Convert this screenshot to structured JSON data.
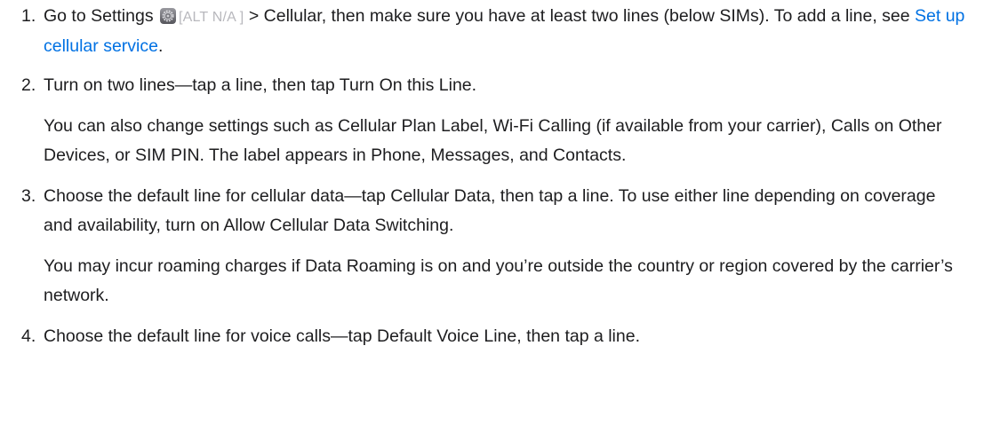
{
  "steps": [
    {
      "number": "1.",
      "parts": {
        "a": "Go to Settings ",
        "alt": "[ALT N/A ]",
        "b": " > Cellular, then make sure you have at least two lines (below SIMs). To add a line, see ",
        "link": "Set up cellular service",
        "c": "."
      },
      "icon": "settings-gear-icon"
    },
    {
      "number": "2.",
      "text": "Turn on two lines—tap a line, then tap Turn On this Line.",
      "note": "You can also change settings such as Cellular Plan Label, Wi-Fi Calling (if available from your carrier), Calls on Other Devices, or SIM PIN. The label appears in Phone, Messages, and Contacts."
    },
    {
      "number": "3.",
      "text": "Choose the default line for cellular data—tap Cellular Data, then tap a line. To use either line depending on coverage and availability, turn on Allow Cellular Data Switching.",
      "note": "You may incur roaming charges if Data Roaming is on and you’re outside the country or region covered by the carrier’s network."
    },
    {
      "number": "4.",
      "text": "Choose the default line for voice calls—tap Default Voice Line, then tap a line."
    }
  ],
  "colors": {
    "text": "#1d1d1f",
    "link": "#0071e3",
    "alt": "#b8b8bd"
  }
}
